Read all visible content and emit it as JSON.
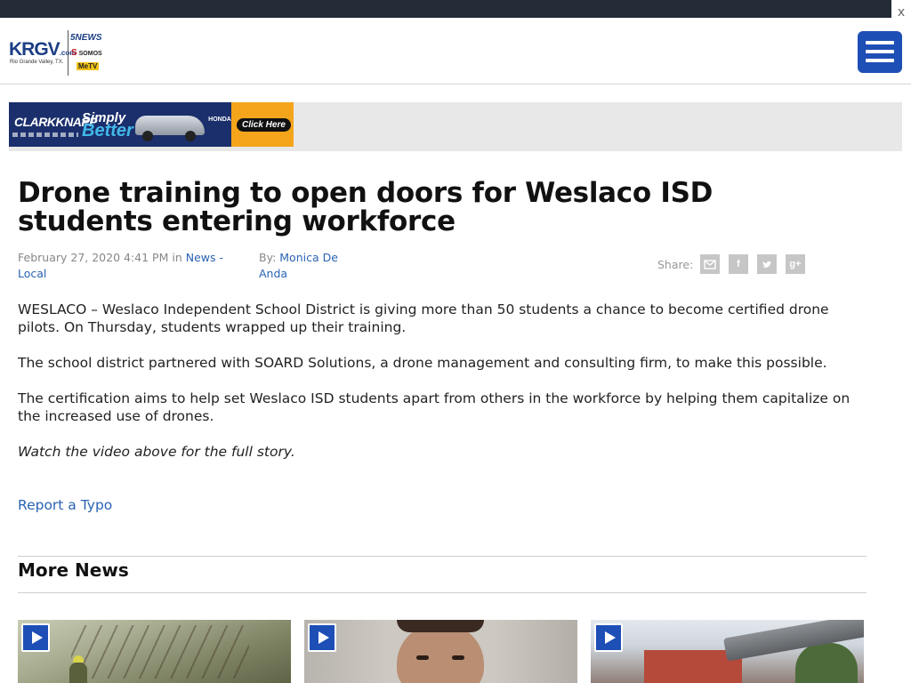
{
  "top_bar": {
    "close_label": "x"
  },
  "header": {
    "logo": {
      "main": "KRGV",
      "dotcom": ".com",
      "sub": "Rio Grande Valley, TX.",
      "news": "5NEWS",
      "somos": "SOMOS",
      "metv": "MeTV"
    }
  },
  "ad": {
    "brand": "CLARKKNAPP",
    "slogan_1": "Simply",
    "slogan_2": "Better",
    "make": "HONDA",
    "cta": "Click Here"
  },
  "article": {
    "title": "Drone training to open doors for Weslaco ISD students entering workforce",
    "date": "February 27, 2020 4:41 PM",
    "in_label": "in",
    "category": "News - Local",
    "by_label": "By:",
    "author": "Monica De Anda",
    "share_label": "Share:",
    "share_buttons": [
      "email",
      "facebook",
      "twitter",
      "google-plus"
    ],
    "paragraphs": [
      "WESLACO – Weslaco Independent School District is giving more than 50 students a chance to become certified drone pilots. On Thursday, students wrapped up their training.",
      "The school district partnered with SOARD Solutions, a drone management and consulting firm, to make this possible.",
      "The certification aims to help set Weslaco ISD students apart from others in the workforce by helping them capitalize on the increased use of drones.",
      "Watch the video above for the full story."
    ],
    "report_typo": "Report a Typo"
  },
  "more_news": {
    "heading": "More News"
  },
  "colors": {
    "accent": "#1e4fb6",
    "link": "#2a63b3",
    "top_bar": "#232b36",
    "share_button": "#c6c6c6"
  }
}
